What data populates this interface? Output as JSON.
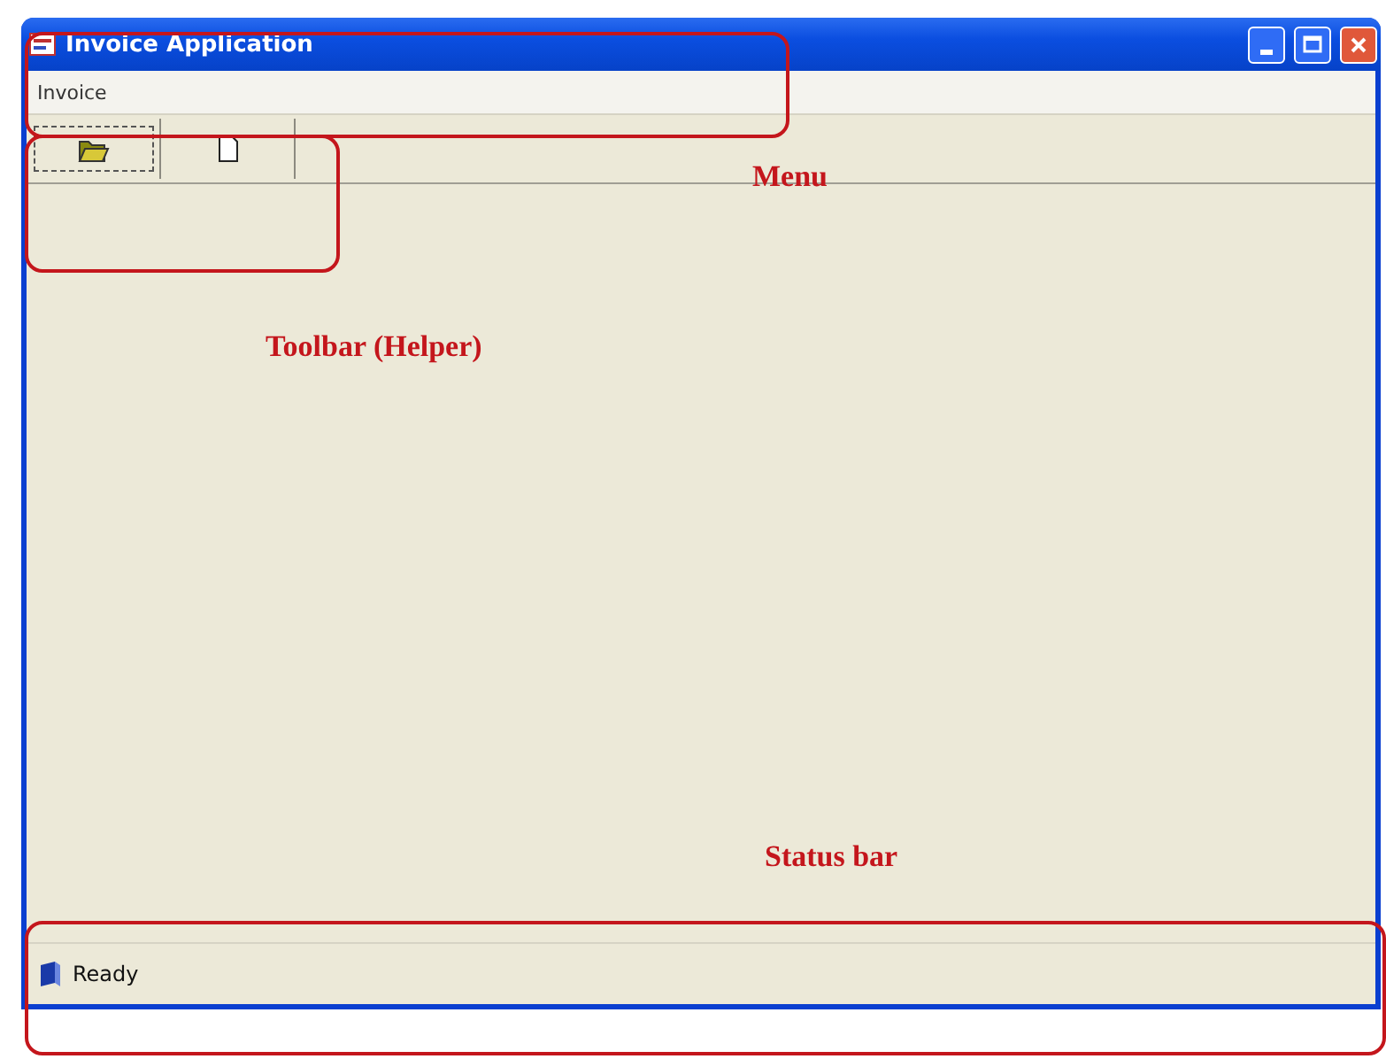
{
  "window": {
    "title": "Invoice Application"
  },
  "menu": [
    {
      "label": "Invoice"
    }
  ],
  "toolbar": [
    {
      "kind": "open",
      "focused": true
    },
    {
      "kind": "new",
      "focused": false
    }
  ],
  "status_bar": {
    "text": "Ready"
  },
  "annotations": [
    {
      "kind": "menu",
      "label": "Menu"
    },
    {
      "kind": "toolbar",
      "label": "Toolbar (Helper)"
    },
    {
      "kind": "status",
      "label": "Status bar"
    }
  ]
}
